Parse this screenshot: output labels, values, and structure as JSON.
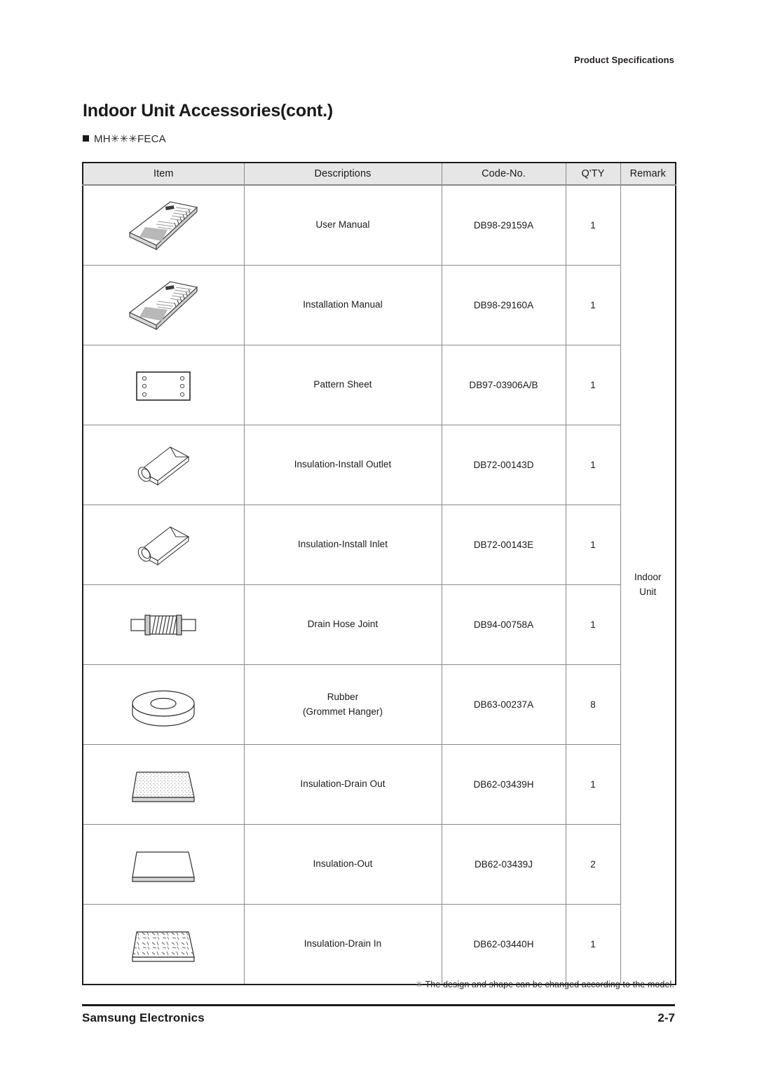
{
  "header": {
    "running_head": "Product Specifications"
  },
  "title_block": {
    "page_title": "Indoor Unit Accessories(cont.)",
    "bullet_icon": "filled-square-bullet",
    "model_name": "MH✳✳✳FECA"
  },
  "table": {
    "columns": [
      {
        "key": "item",
        "label": "Item"
      },
      {
        "key": "desc",
        "label": "Descriptions"
      },
      {
        "key": "code",
        "label": "Code-No."
      },
      {
        "key": "qty",
        "label": "Q'TY"
      },
      {
        "key": "remark",
        "label": "Remark"
      }
    ],
    "remark_value": "Indoor\nUnit",
    "remark_line1": "Indoor",
    "remark_line2": "Unit",
    "rows": [
      {
        "illustration": "booklet-manual-icon",
        "desc": "User Manual",
        "desc_line2": "",
        "code": "DB98-29159A",
        "qty": "1"
      },
      {
        "illustration": "booklet-manual-icon",
        "desc": "Installation Manual",
        "desc_line2": "",
        "code": "DB98-29160A",
        "qty": "1"
      },
      {
        "illustration": "pattern-sheet-icon",
        "desc": "Pattern Sheet",
        "desc_line2": "",
        "code": "DB97-03906A/B",
        "qty": "1"
      },
      {
        "illustration": "insulation-tube-icon",
        "desc": "Insulation-Install Outlet",
        "desc_line2": "",
        "code": "DB72-00143D",
        "qty": "1"
      },
      {
        "illustration": "insulation-tube-icon",
        "desc": "Insulation-Install Inlet",
        "desc_line2": "",
        "code": "DB72-00143E",
        "qty": "1"
      },
      {
        "illustration": "drain-hose-joint-icon",
        "desc": "Drain Hose Joint",
        "desc_line2": "",
        "code": "DB94-00758A",
        "qty": "1"
      },
      {
        "illustration": "rubber-grommet-icon",
        "desc": "Rubber",
        "desc_line2": "(Grommet Hanger)",
        "code": "DB63-00237A",
        "qty": "8"
      },
      {
        "illustration": "insulation-pad-fine-icon",
        "desc": "Insulation-Drain Out",
        "desc_line2": "",
        "code": "DB62-03439H",
        "qty": "1"
      },
      {
        "illustration": "insulation-pad-plain-icon",
        "desc": "Insulation-Out",
        "desc_line2": "",
        "code": "DB62-03439J",
        "qty": "2"
      },
      {
        "illustration": "insulation-pad-coarse-icon",
        "desc": "Insulation-Drain In",
        "desc_line2": "",
        "code": "DB62-03440H",
        "qty": "1"
      }
    ]
  },
  "footnote": {
    "star": "✳",
    "text": "The design and shape can be changed according to the model."
  },
  "footer": {
    "brand": "Samsung Electronics",
    "page_number": "2-7"
  },
  "colors": {
    "text": "#1a1a1a",
    "header_fill": "#e6e6e6",
    "grid_line": "#8a8a8a",
    "outer_border": "#1c1c1c"
  }
}
